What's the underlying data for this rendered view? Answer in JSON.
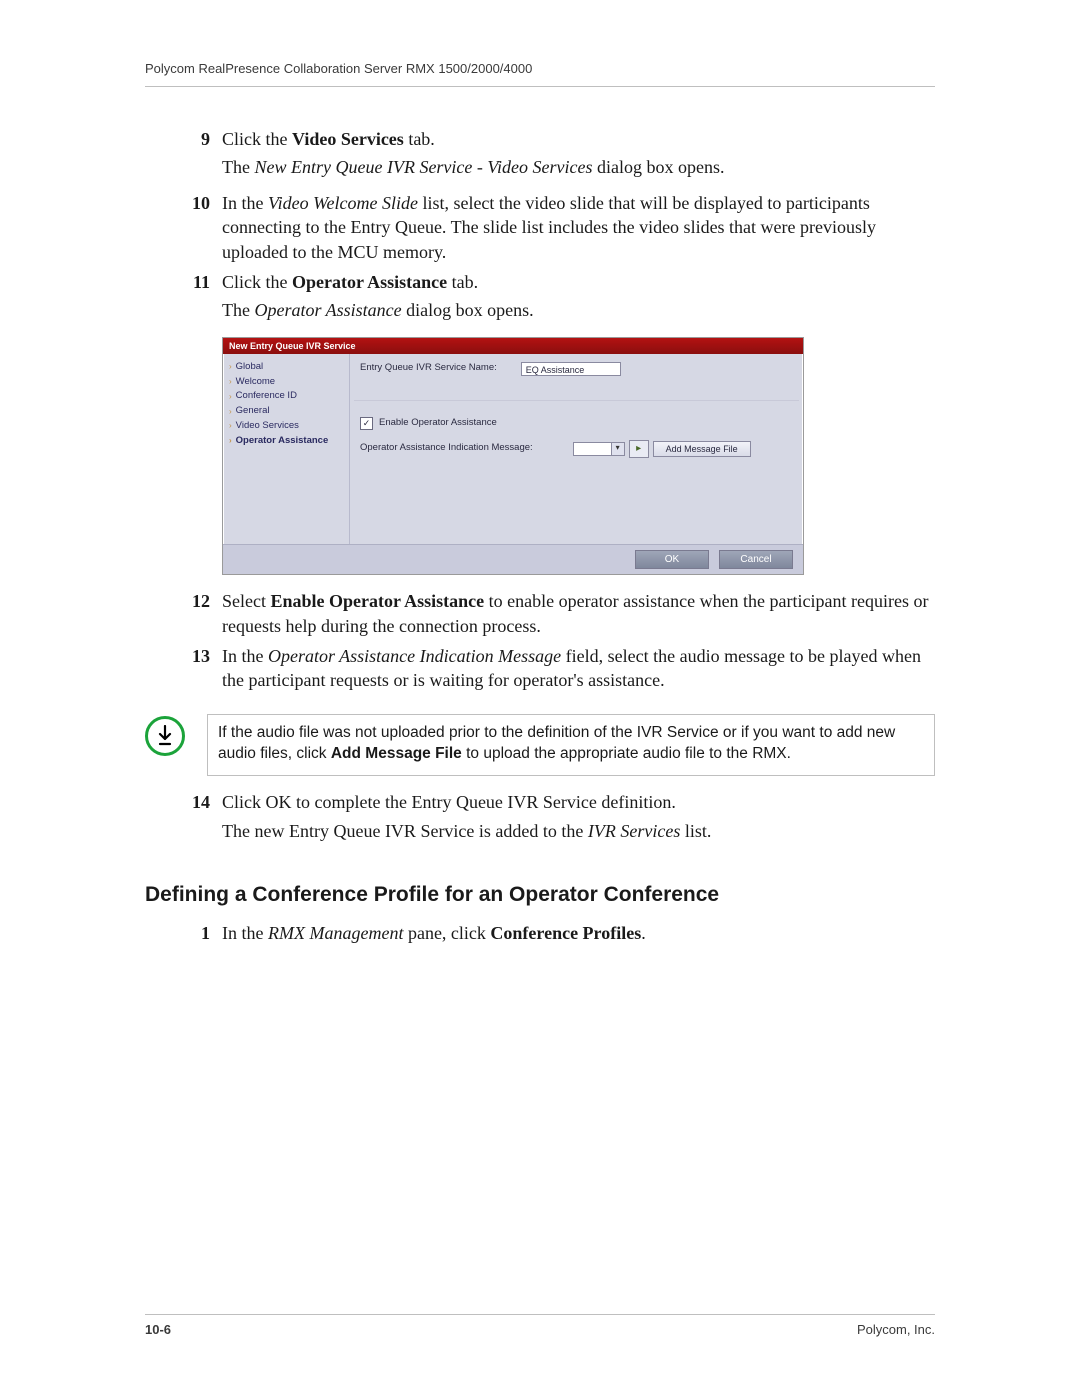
{
  "header": "Polycom RealPresence Collaboration Server RMX 1500/2000/4000",
  "steps": {
    "s9": {
      "num": "9",
      "line": {
        "pre": "Click the ",
        "bold": "Video Services",
        "post": " tab."
      },
      "sub": {
        "pre": "The ",
        "ital": "New Entry Queue IVR Service - Video Services",
        "post": " dialog box opens."
      }
    },
    "s10": {
      "num": "10",
      "text_pre": "In the ",
      "text_ital": "Video Welcome Slide",
      "text_post": " list, select the video slide that will be displayed to participants connecting to the Entry Queue. The slide list includes the video slides that were previously uploaded to the MCU memory."
    },
    "s11": {
      "num": "11",
      "line": {
        "pre": "Click the ",
        "bold": "Operator Assistance",
        "post": " tab."
      },
      "sub": {
        "pre": "The ",
        "ital": "Operator Assistance",
        "post": " dialog box opens."
      }
    },
    "s12": {
      "num": "12",
      "text_pre": "Select ",
      "text_bold": "Enable Operator Assistance",
      "text_post": " to enable operator assistance when the participant requires or requests help during the connection process."
    },
    "s13": {
      "num": "13",
      "text_pre": "In the ",
      "text_ital": "Operator Assistance Indication Message",
      "text_post": " field, select the audio message to be played when the participant requests or is waiting for operator's assistance."
    },
    "s14": {
      "num": "14",
      "line1": "Click OK to complete the Entry Queue IVR Service definition.",
      "line2_pre": "The new Entry Queue IVR Service is added to the ",
      "line2_ital": "IVR Services",
      "line2_post": " list."
    },
    "h2": "Defining a Conference Profile for an Operator Conference",
    "s_b1": {
      "num": "1",
      "text_pre": "In the ",
      "text_ital": "RMX Management",
      "text_mid": " pane, click ",
      "text_bold": "Conference Profiles",
      "text_post": "."
    }
  },
  "dialog": {
    "title": "New Entry Queue IVR Service",
    "sidebar": [
      "Global",
      "Welcome",
      "Conference ID",
      "General",
      "Video Services",
      "Operator Assistance"
    ],
    "name_label": "Entry Queue IVR Service Name:",
    "name_value": "EQ Assistance",
    "enable_label": "Enable Operator Assistance",
    "msg_label": "Operator Assistance Indication Message:",
    "add_btn": "Add Message File",
    "ok": "OK",
    "cancel": "Cancel"
  },
  "note": {
    "pre": "If the audio file was not uploaded prior to the definition of the IVR Service or if you want to add new audio files, click ",
    "bold": "Add Message File",
    "post": " to upload the appropriate audio file to the RMX."
  },
  "footer": {
    "left": "10-6",
    "right": "Polycom, Inc."
  }
}
